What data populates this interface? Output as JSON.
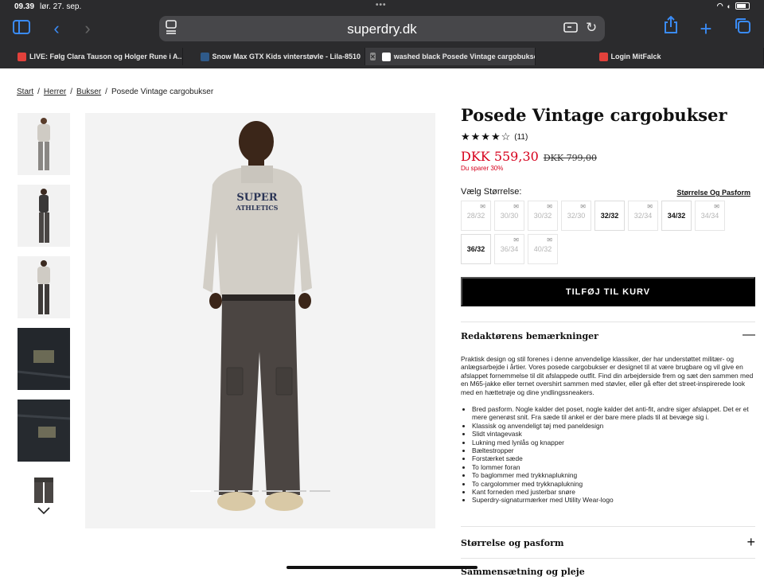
{
  "status": {
    "time": "09.39",
    "date": "lør. 27. sep."
  },
  "browser": {
    "url": "superdry.dk",
    "tabs": [
      {
        "label": "LIVE: Følg Clara Tauson og Holger Rune i A...",
        "favicon_color": "#e2413b"
      },
      {
        "label": "Snow Max GTX Kids vinterstøvle - Lila-8510",
        "favicon_color": "#2f5a8a"
      },
      {
        "label": "washed black Posede Vintage cargobukse...",
        "favicon_color": "#ffffff",
        "active": true
      },
      {
        "label": "Login MitFalck",
        "favicon_color": "#e2413b"
      }
    ]
  },
  "breadcrumb": {
    "items": [
      "Start",
      "Herrer",
      "Bukser"
    ],
    "current": "Posede Vintage cargobukser"
  },
  "product": {
    "title": "Posede Vintage cargobukser",
    "stars": "★★★★☆",
    "review_count": "(11)",
    "rating_value": 4.5,
    "price_now": "DKK 559,30",
    "price_was": "DKK 799,00",
    "saving": "Du sparer 30%",
    "size_label": "Vælg Størrelse:",
    "size_guide": "Størrelse Og Pasform",
    "sizes": [
      {
        "label": "28/32",
        "available": false
      },
      {
        "label": "30/30",
        "available": false
      },
      {
        "label": "30/32",
        "available": false
      },
      {
        "label": "32/30",
        "available": false
      },
      {
        "label": "32/32",
        "available": true
      },
      {
        "label": "32/34",
        "available": false
      },
      {
        "label": "34/32",
        "available": true
      },
      {
        "label": "34/34",
        "available": false
      },
      {
        "label": "36/32",
        "available": true
      },
      {
        "label": "36/34",
        "available": false
      },
      {
        "label": "40/32",
        "available": false
      }
    ],
    "add_to_cart": "TILFØJ TIL KURV",
    "editor_title": "Redaktørens bemærkninger",
    "editor_text": "Praktisk design og stil forenes i denne anvendelige klassiker, der har understøttet militær- og anlægsarbejde i årtier. Vores posede cargobukser er designet til at være brugbare og vil give en afslappet fornemmelse til dit afslappede outfit. Find din arbejderside frem og sæt den sammen med en M65-jakke eller ternet overshirt sammen med støvler, eller gå efter det street-inspirerede look med en hættetrøje og dine yndlingssneakers.",
    "features": [
      "Bred pasform. Nogle kalder det poset, nogle kalder det anti-fit, andre siger afslappet. Det er et mere generøst snit. Fra sæde til ankel er der bare mere plads til at bevæge sig i.",
      "Klassisk og anvendeligt tøj med paneldesign",
      "Slidt vintagevask",
      "Lukning med lynlås og knapper",
      "Bæltestropper",
      "Forstærket sæde",
      "To lommer foran",
      "To baglommer med trykknaplukning",
      "To cargolommer med trykknaplukning",
      "Kant forneden med justerbar snøre",
      "Superdry-signaturmærker med Utility Wear-logo"
    ],
    "size_fit_title": "Størrelse og pasform",
    "next_section_title": "Sammensætning og pleje"
  }
}
